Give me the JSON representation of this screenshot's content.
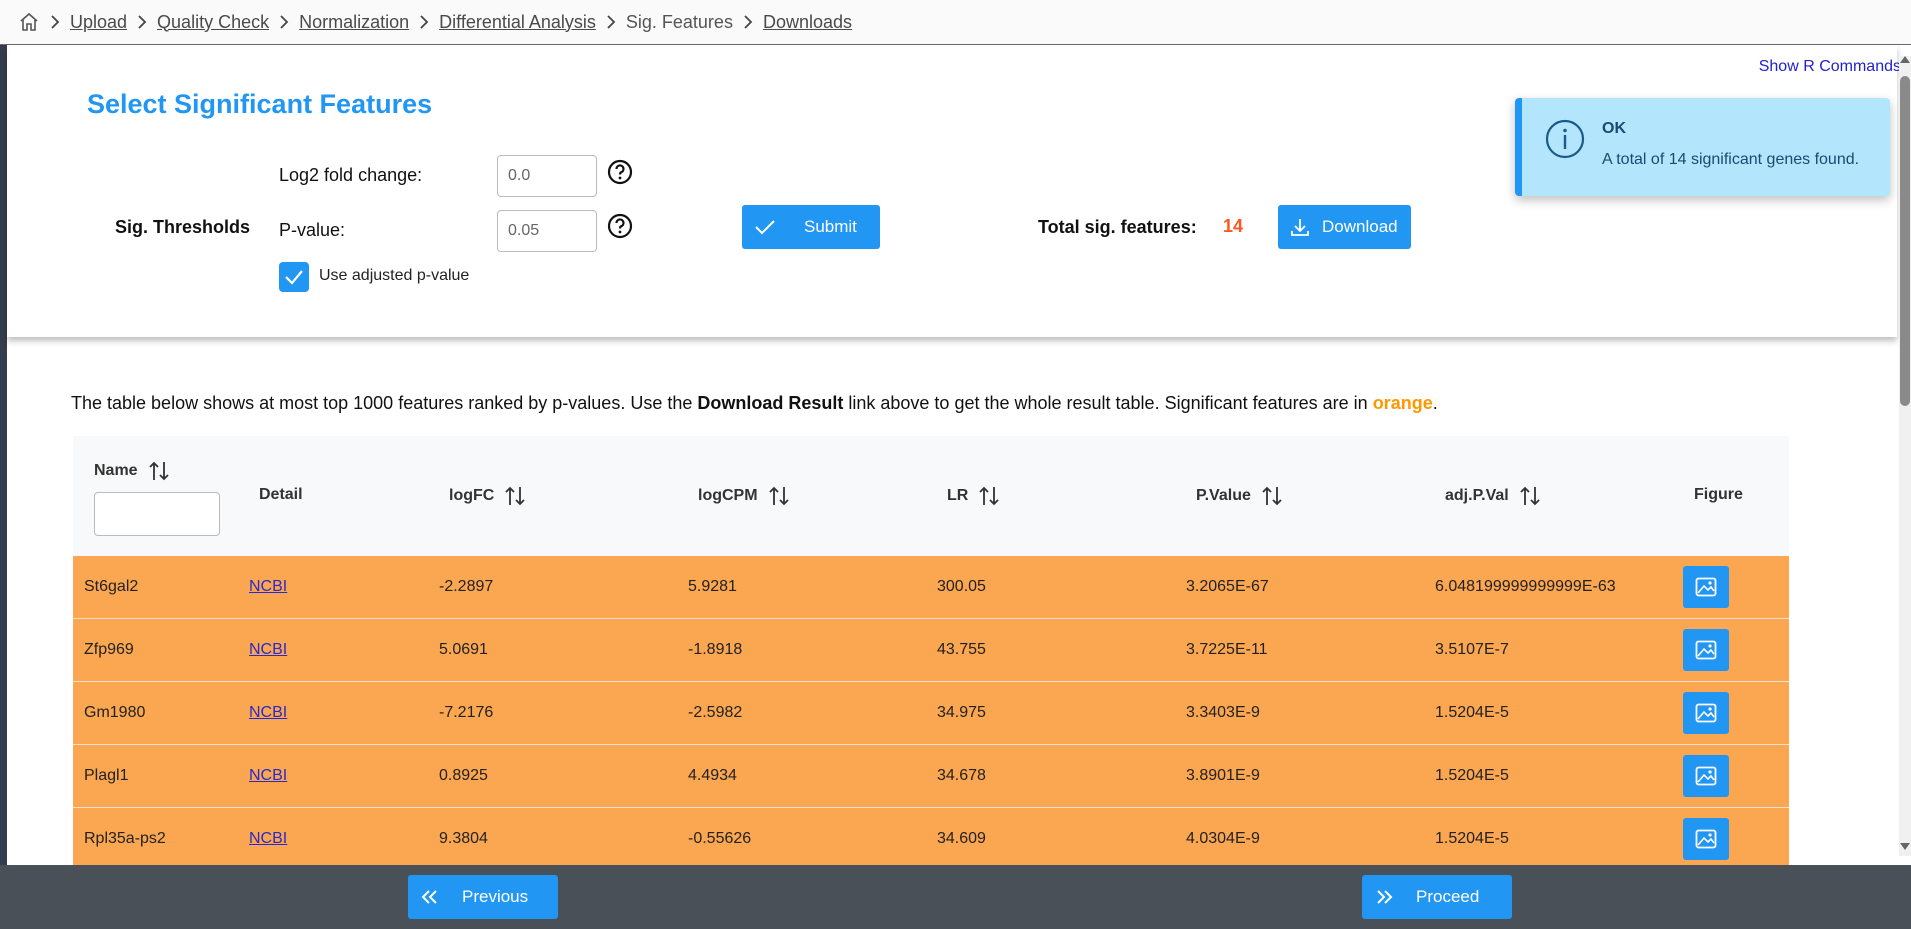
{
  "breadcrumb": {
    "items": [
      {
        "label": "Upload",
        "link": true
      },
      {
        "label": "Quality Check",
        "link": true
      },
      {
        "label": "Normalization",
        "link": true
      },
      {
        "label": "Differential Analysis",
        "link": true
      },
      {
        "label": "Sig. Features",
        "link": false
      },
      {
        "label": "Downloads",
        "link": true
      }
    ]
  },
  "show_r_commands": "Show R Commands",
  "panel": {
    "title": "Select Significant Features",
    "thresholds_label": "Sig. Thresholds",
    "log2fc_label": "Log2 fold change:",
    "log2fc_value": "0.0",
    "pvalue_label": "P-value:",
    "pvalue_value": "0.05",
    "use_adjusted_label": "Use adjusted p-value",
    "use_adjusted_checked": true,
    "submit_label": "Submit",
    "total_label": "Total sig. features:",
    "total_value": "14",
    "download_label": "Download"
  },
  "toast": {
    "title": "OK",
    "message": "A total of 14 significant genes found."
  },
  "intro": {
    "part1": "The table below shows at most top 1000 features ranked by p-values. Use the ",
    "bold": "Download Result",
    "part2": " link above to get the whole result table. Significant features are in ",
    "orange": "orange",
    "part3": "."
  },
  "table": {
    "headers": [
      "Name",
      "Detail",
      "logFC",
      "logCPM",
      "LR",
      "P.Value",
      "adj.P.Val",
      "Figure"
    ],
    "rows": [
      {
        "name": "St6gal2",
        "detail": "NCBI",
        "logfc": "-2.2897",
        "logcpm": "5.9281",
        "lr": "300.05",
        "pvalue": "3.2065E-67",
        "adjp": "6.048199999999999E-63"
      },
      {
        "name": "Zfp969",
        "detail": "NCBI",
        "logfc": "5.0691",
        "logcpm": "-1.8918",
        "lr": "43.755",
        "pvalue": "3.7225E-11",
        "adjp": "3.5107E-7"
      },
      {
        "name": "Gm1980",
        "detail": "NCBI",
        "logfc": "-7.2176",
        "logcpm": "-2.5982",
        "lr": "34.975",
        "pvalue": "3.3403E-9",
        "adjp": "1.5204E-5"
      },
      {
        "name": "Plagl1",
        "detail": "NCBI",
        "logfc": "0.8925",
        "logcpm": "4.4934",
        "lr": "34.678",
        "pvalue": "3.8901E-9",
        "adjp": "1.5204E-5"
      },
      {
        "name": "Rpl35a-ps2",
        "detail": "NCBI",
        "logfc": "9.3804",
        "logcpm": "-0.55626",
        "lr": "34.609",
        "pvalue": "4.0304E-9",
        "adjp": "1.5204E-5"
      }
    ]
  },
  "nav": {
    "previous_label": "Previous",
    "proceed_label": "Proceed"
  },
  "colors": {
    "accent": "#2196f3",
    "row_significant": "#fba651",
    "total_value": "#ff5722",
    "toast_bg": "#b3e5fc"
  }
}
